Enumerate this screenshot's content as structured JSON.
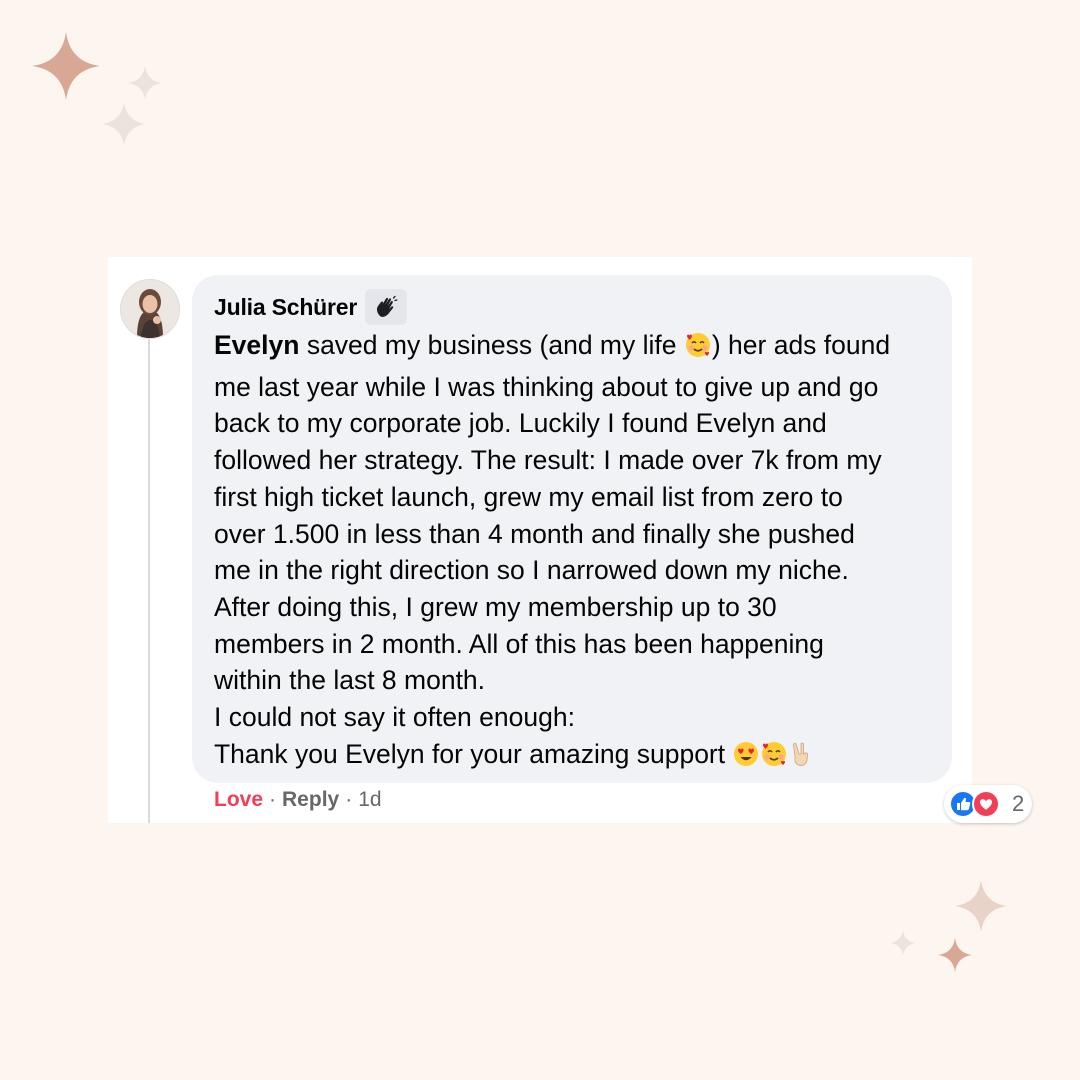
{
  "comment": {
    "author": "Julia Schürer",
    "badge_icon": "waving-hand-icon",
    "lines": [
      {
        "mention": "Evelyn",
        "text": " saved my business (and my life ",
        "emoji": "smiling-face-with-hearts-icon",
        "after": ") her ads found"
      },
      {
        "text": "me last year while I was thinking about to give up and go"
      },
      {
        "text": "back to my corporate job. Luckily I found Evelyn and"
      },
      {
        "text": "followed her strategy. The result: I made over 7k from my"
      },
      {
        "text": "first high ticket launch, grew my email list from zero to"
      },
      {
        "text": "over 1.500 in less than 4 month and finally she pushed"
      },
      {
        "text": "me in the right direction so I narrowed down my niche."
      },
      {
        "text": "After doing this, I grew my membership up to 30"
      },
      {
        "text": "members in 2 month. All of this has been happening"
      },
      {
        "text": "within the last 8 month."
      },
      {
        "text": "I could not say it often enough:"
      },
      {
        "text": "Thank you Evelyn for your amazing support ",
        "end_emojis": [
          "heart-eyes-icon",
          "smiling-face-with-hearts-icon",
          "victory-hand-icon"
        ]
      }
    ],
    "reactions": {
      "icons": [
        "like-reaction-icon",
        "love-reaction-icon"
      ],
      "count": "2"
    },
    "actions": {
      "love": "Love",
      "reply": "Reply",
      "separator": "·",
      "time": "1d"
    }
  },
  "colors": {
    "background": "#fdf5f0",
    "bubble": "#f0f2f5",
    "love_action": "#f33e58",
    "like_blue": "#1877f2",
    "love_red": "#f33e58",
    "sparkle_dark": "#d9a894",
    "sparkle_light": "#ece3de"
  }
}
